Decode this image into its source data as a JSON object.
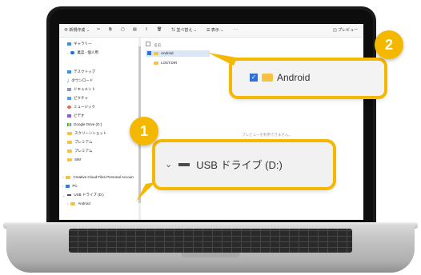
{
  "toolbar": {
    "new_label": "新規作成",
    "sort_label": "並べ替え",
    "view_label": "表示",
    "more_label": "···",
    "preview_label": "プレビュー"
  },
  "sidebar": {
    "gallery": "ギャラリー",
    "account": "菓菜 - 個人用",
    "desktop": "デスクトップ",
    "downloads": "ダウンロード",
    "documents": "ドキュメント",
    "pictures": "ピクチャ",
    "music": "ミュージック",
    "videos": "ビデオ",
    "google_drive": "Google Drive (G:)",
    "screenshots": "スクリーンショット",
    "premium1": "プレミアム",
    "premium2": "プレミアム",
    "sim": "SIM",
    "creative_cloud": "Creative Cloud Files Personal Accoun",
    "pc": "PC",
    "usb": "USB ドライブ (D:)",
    "android": "Android"
  },
  "content": {
    "column_name": "名前",
    "files": [
      "Android",
      "LOST.DIR"
    ],
    "preview_message": "プレビューを利用できません。"
  },
  "callouts": [
    {
      "number": "1",
      "text": "USB ドライブ (D:)"
    },
    {
      "number": "2",
      "text": "Android"
    }
  ],
  "colors": {
    "accent": "#f5b800",
    "selection": "#dce7f6",
    "folder": "#f5c242",
    "checkbox": "#2f6fd6"
  }
}
